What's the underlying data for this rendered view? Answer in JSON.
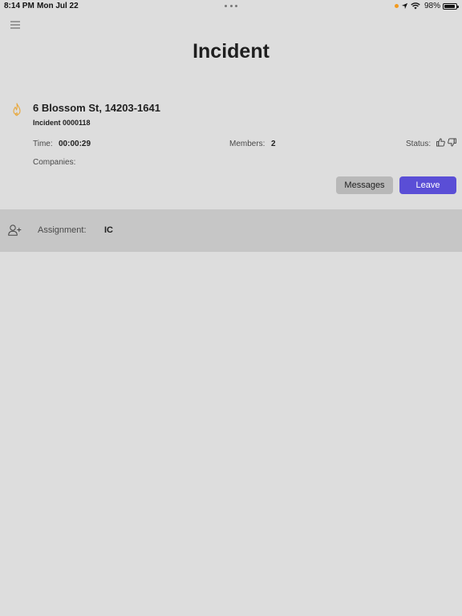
{
  "status_bar": {
    "time": "8:14 PM",
    "date": "Mon Jul 22",
    "battery": "98%",
    "icons": [
      "orange-dot",
      "location-arrow-icon",
      "wifi-icon",
      "battery-icon"
    ]
  },
  "nav": {
    "menu_icon": "hamburger-icon"
  },
  "header": {
    "title": "Incident"
  },
  "incident": {
    "icon": "fire-icon",
    "address": "6 Blossom St, 14203-1641",
    "number": "Incident 0000118",
    "time_label": "Time:",
    "time_value": "00:00:29",
    "members_label": "Members:",
    "members_value": "2",
    "status_label": "Status:",
    "status_icons": [
      "thumbs-up-icon",
      "thumbs-down-icon"
    ],
    "companies_label": "Companies:",
    "messages_button": "Messages",
    "leave_button": "Leave"
  },
  "assignment": {
    "icon": "add-user-icon",
    "label": "Assignment:",
    "value": "IC"
  },
  "colors": {
    "background": "#dddddd",
    "assignment_row": "#c6c6c6",
    "accent": "#5a4ed6",
    "fire_icon": "#e8a73a",
    "messages_button": "#b8b8b8"
  }
}
